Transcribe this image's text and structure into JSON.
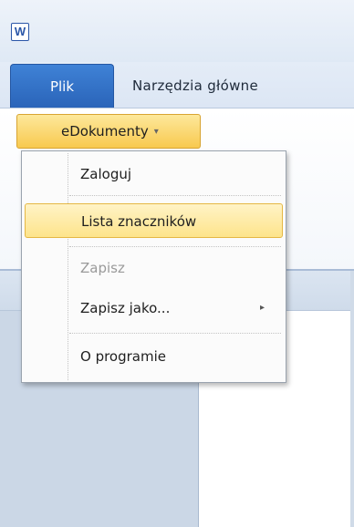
{
  "app": {
    "icon_letter": "W"
  },
  "ribbon": {
    "tabs": [
      {
        "label": "Plik",
        "active": true
      },
      {
        "label": "Narzędzia główne",
        "active": false
      }
    ],
    "edokumenty_button": {
      "label": "eDokumenty",
      "chevron": "▾"
    }
  },
  "menu": {
    "items": [
      {
        "label": "Zaloguj",
        "state": "normal"
      },
      {
        "label": "Lista znaczników",
        "state": "selected"
      },
      {
        "label": "Zapisz",
        "state": "disabled"
      },
      {
        "label": "Zapisz jako...",
        "state": "normal",
        "submenu": "▸"
      },
      {
        "label": "O programie",
        "state": "normal"
      }
    ]
  },
  "colors": {
    "file_tab": "#2a64b9",
    "highlight": "#fde48b",
    "disabled_text": "#9a9a9a"
  }
}
